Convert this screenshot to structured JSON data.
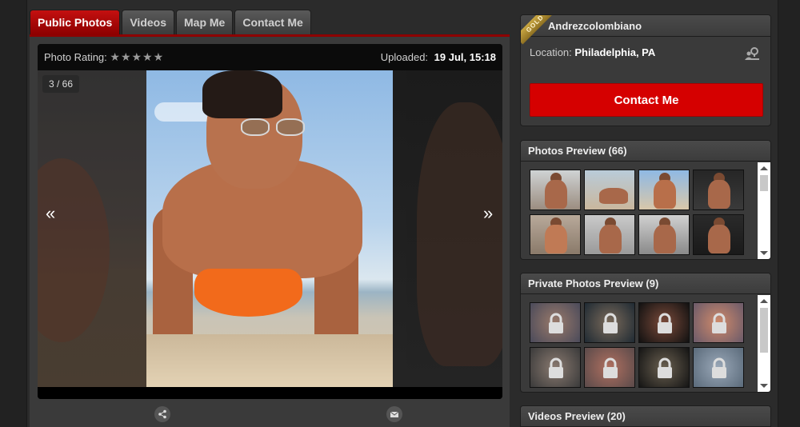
{
  "tabs": [
    {
      "label": "Public Photos",
      "active": true
    },
    {
      "label": "Videos",
      "active": false
    },
    {
      "label": "Map Me",
      "active": false
    },
    {
      "label": "Contact Me",
      "active": false
    }
  ],
  "viewer": {
    "rating_label": "Photo Rating:",
    "stars": "★★★★★",
    "uploaded_label": "Uploaded:",
    "uploaded_value": "19 Jul, 15:18",
    "counter": "3 / 66",
    "prev_arrow": "«",
    "next_arrow": "»",
    "share_icon": "share-icon",
    "mail_icon": "envelope-icon"
  },
  "profile": {
    "badge": "GOLD",
    "username": "Andrezcolombiano",
    "location_label": "Location:",
    "location_value": "Philadelphia, PA",
    "location_icon": "map-pin-user-icon",
    "contact_button": "Contact Me"
  },
  "photos_preview": {
    "title": "Photos Preview (66)"
  },
  "private_preview": {
    "title": "Private Photos Preview (9)",
    "lock_icon": "lock-icon"
  },
  "videos_preview": {
    "title": "Videos Preview (20)"
  },
  "colors": {
    "accent_red": "#d50000",
    "tab_active": "#c41010",
    "gold_badge": "#c9a742",
    "panel_bg": "#3a3a3a",
    "page_bg": "#2b2b2b"
  }
}
